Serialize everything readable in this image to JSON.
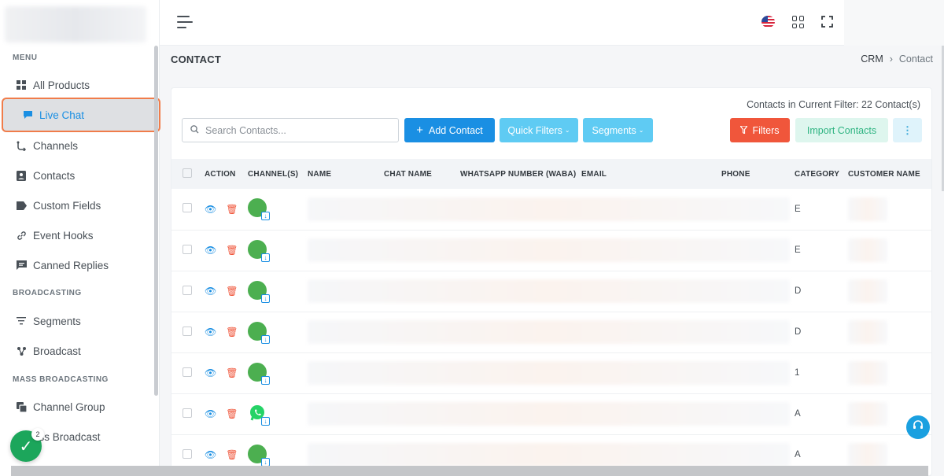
{
  "sidebar": {
    "sections": {
      "menu": "MENU",
      "broadcasting": "BROADCASTING",
      "mass_broadcasting": "MASS BROADCASTING"
    },
    "items": [
      {
        "label": "All Products",
        "icon": "grid-icon"
      },
      {
        "label": "Live Chat",
        "icon": "chat-icon",
        "active": true
      },
      {
        "label": "Channels",
        "icon": "channels-icon"
      },
      {
        "label": "Contacts",
        "icon": "contacts-icon"
      },
      {
        "label": "Custom Fields",
        "icon": "tag-icon"
      },
      {
        "label": "Event Hooks",
        "icon": "link-icon"
      },
      {
        "label": "Canned Replies",
        "icon": "message-icon"
      },
      {
        "label": "Segments",
        "icon": "filter-icon"
      },
      {
        "label": "Broadcast",
        "icon": "broadcast-icon"
      },
      {
        "label": "Channel Group",
        "icon": "group-icon"
      },
      {
        "label": "ass Broadcast",
        "icon": "broadcast-icon"
      }
    ]
  },
  "header": {
    "page_title": "CONTACT",
    "breadcrumb": [
      "CRM",
      "Contact"
    ]
  },
  "toolbar": {
    "filter_count": "Contacts in Current Filter: 22 Contact(s)",
    "search_placeholder": "Search Contacts...",
    "add_contact": "Add Contact",
    "quick_filters": "Quick Filters",
    "segments": "Segments",
    "filters": "Filters",
    "import_contacts": "Import Contacts"
  },
  "table": {
    "columns": [
      "ACTION",
      "CHANNEL(S)",
      "NAME",
      "CHAT NAME",
      "WHATSAPP NUMBER (WABA)",
      "EMAIL",
      "PHONE",
      "CATEGORY",
      "CUSTOMER NAME"
    ],
    "rows": [
      {
        "channel": "generic",
        "category": "E"
      },
      {
        "channel": "generic",
        "category": "E"
      },
      {
        "channel": "generic",
        "category": "D"
      },
      {
        "channel": "generic",
        "category": "D"
      },
      {
        "channel": "generic",
        "category": "1"
      },
      {
        "channel": "whatsapp",
        "category": "A"
      },
      {
        "channel": "generic",
        "category": "A"
      }
    ]
  },
  "notifications": {
    "badge_count": "2"
  },
  "colors": {
    "primary": "#1a8fe3",
    "danger": "#f0563b",
    "info": "#5fcbf3",
    "success": "#1ca65b",
    "active_outline": "#f07c4a"
  }
}
